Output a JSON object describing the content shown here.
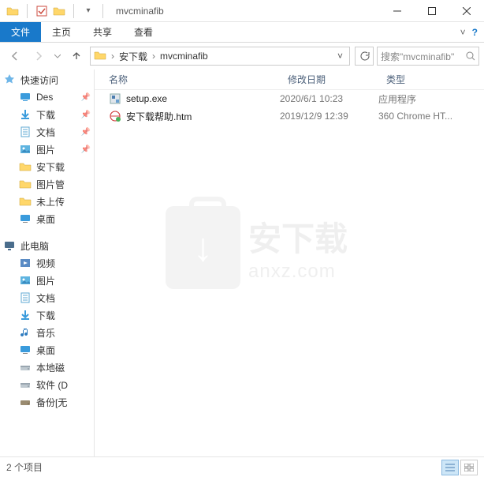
{
  "title": "mvcminafib",
  "ribbon": {
    "file": "文件",
    "home": "主页",
    "share": "共享",
    "view": "查看"
  },
  "breadcrumb": {
    "seg1": "安下载",
    "seg2": "mvcminafib"
  },
  "search": {
    "placeholder": "搜索\"mvcminafib\""
  },
  "columns": {
    "name": "名称",
    "date": "修改日期",
    "type": "类型"
  },
  "files": [
    {
      "name": "setup.exe",
      "date": "2020/6/1 10:23",
      "type": "应用程序",
      "icon": "exe"
    },
    {
      "name": "安下载帮助.htm",
      "date": "2019/12/9 12:39",
      "type": "360 Chrome HT...",
      "icon": "htm"
    }
  ],
  "nav": {
    "quick": "快速访问",
    "quick_items": [
      {
        "label": "Des",
        "icon": "desktop",
        "pinned": true
      },
      {
        "label": "下载",
        "icon": "download",
        "pinned": true
      },
      {
        "label": "文档",
        "icon": "doc",
        "pinned": true
      },
      {
        "label": "图片",
        "icon": "pic",
        "pinned": true
      },
      {
        "label": "安下载",
        "icon": "folder"
      },
      {
        "label": "图片管",
        "icon": "folder"
      },
      {
        "label": "未上传",
        "icon": "folder"
      },
      {
        "label": "桌面",
        "icon": "desktop2"
      }
    ],
    "thispc": "此电脑",
    "pc_items": [
      {
        "label": "视频",
        "icon": "video"
      },
      {
        "label": "图片",
        "icon": "pic"
      },
      {
        "label": "文档",
        "icon": "doc"
      },
      {
        "label": "下载",
        "icon": "download"
      },
      {
        "label": "音乐",
        "icon": "music"
      },
      {
        "label": "桌面",
        "icon": "desktop2"
      },
      {
        "label": "本地磁",
        "icon": "drive"
      },
      {
        "label": "软件 (D",
        "icon": "drive"
      },
      {
        "label": "备份[无",
        "icon": "drive2"
      }
    ]
  },
  "status": "2 个项目",
  "watermark": {
    "l1": "安下载",
    "l2": "anxz.com"
  }
}
